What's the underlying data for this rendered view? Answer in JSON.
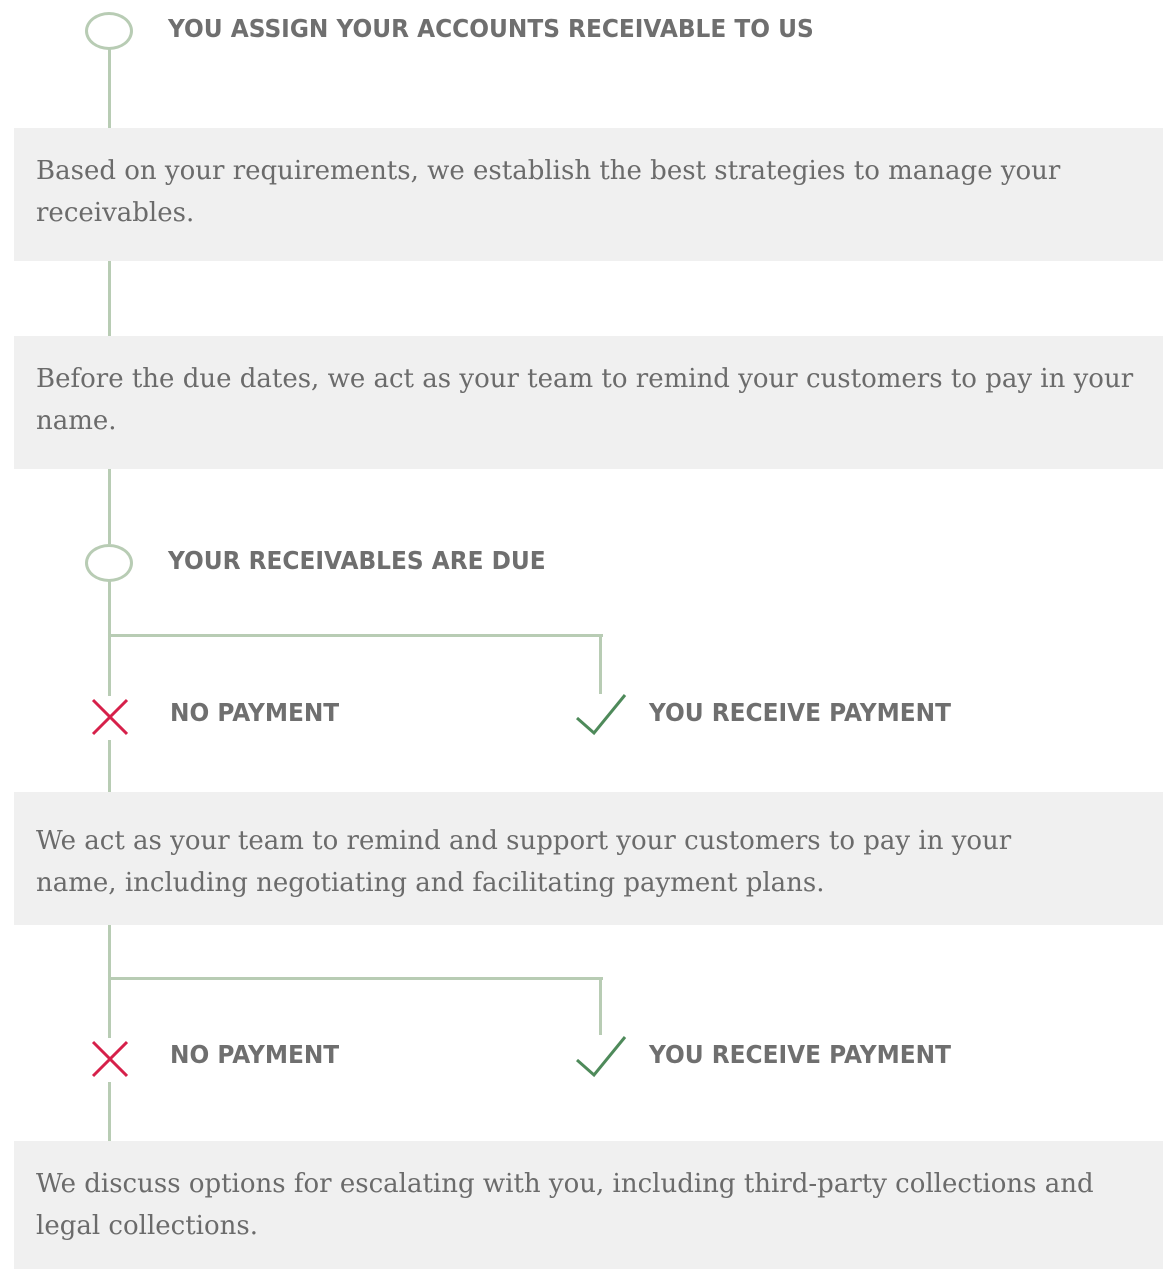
{
  "steps": {
    "assign": {
      "title": "YOU ASSIGN YOUR ACCOUNTS RECEIVABLE TO US"
    },
    "strategy": {
      "lines": [
        "Based on your requirements, we establish the best strategies to manage your",
        "receivables."
      ]
    },
    "remind": {
      "lines": [
        "Before the due dates, we act as your team to remind your customers to pay in your",
        "name."
      ]
    },
    "due": {
      "title": "YOUR RECEIVABLES ARE DUE"
    },
    "branch1": {
      "no_payment": "NO PAYMENT",
      "payment": "YOU RECEIVE PAYMENT"
    },
    "support": {
      "lines": [
        "We act as your team to remind and support your customers to pay in your",
        "name, including negotiating and facilitating payment plans."
      ]
    },
    "branch2": {
      "no_payment": "NO PAYMENT",
      "payment": "YOU RECEIVE PAYMENT"
    },
    "escalate": {
      "lines": [
        "We discuss options for escalating with you, including third-party collections and",
        "legal collections."
      ]
    }
  },
  "colors": {
    "connector": "#b8ccb4",
    "box_bg": "#f0f0f0",
    "cross": "#d6204a",
    "check": "#4e8a5a",
    "text": "#6b6b6b"
  },
  "icons": {
    "no_payment": "cross-icon",
    "payment": "check-icon",
    "node": "circle-node-icon"
  }
}
